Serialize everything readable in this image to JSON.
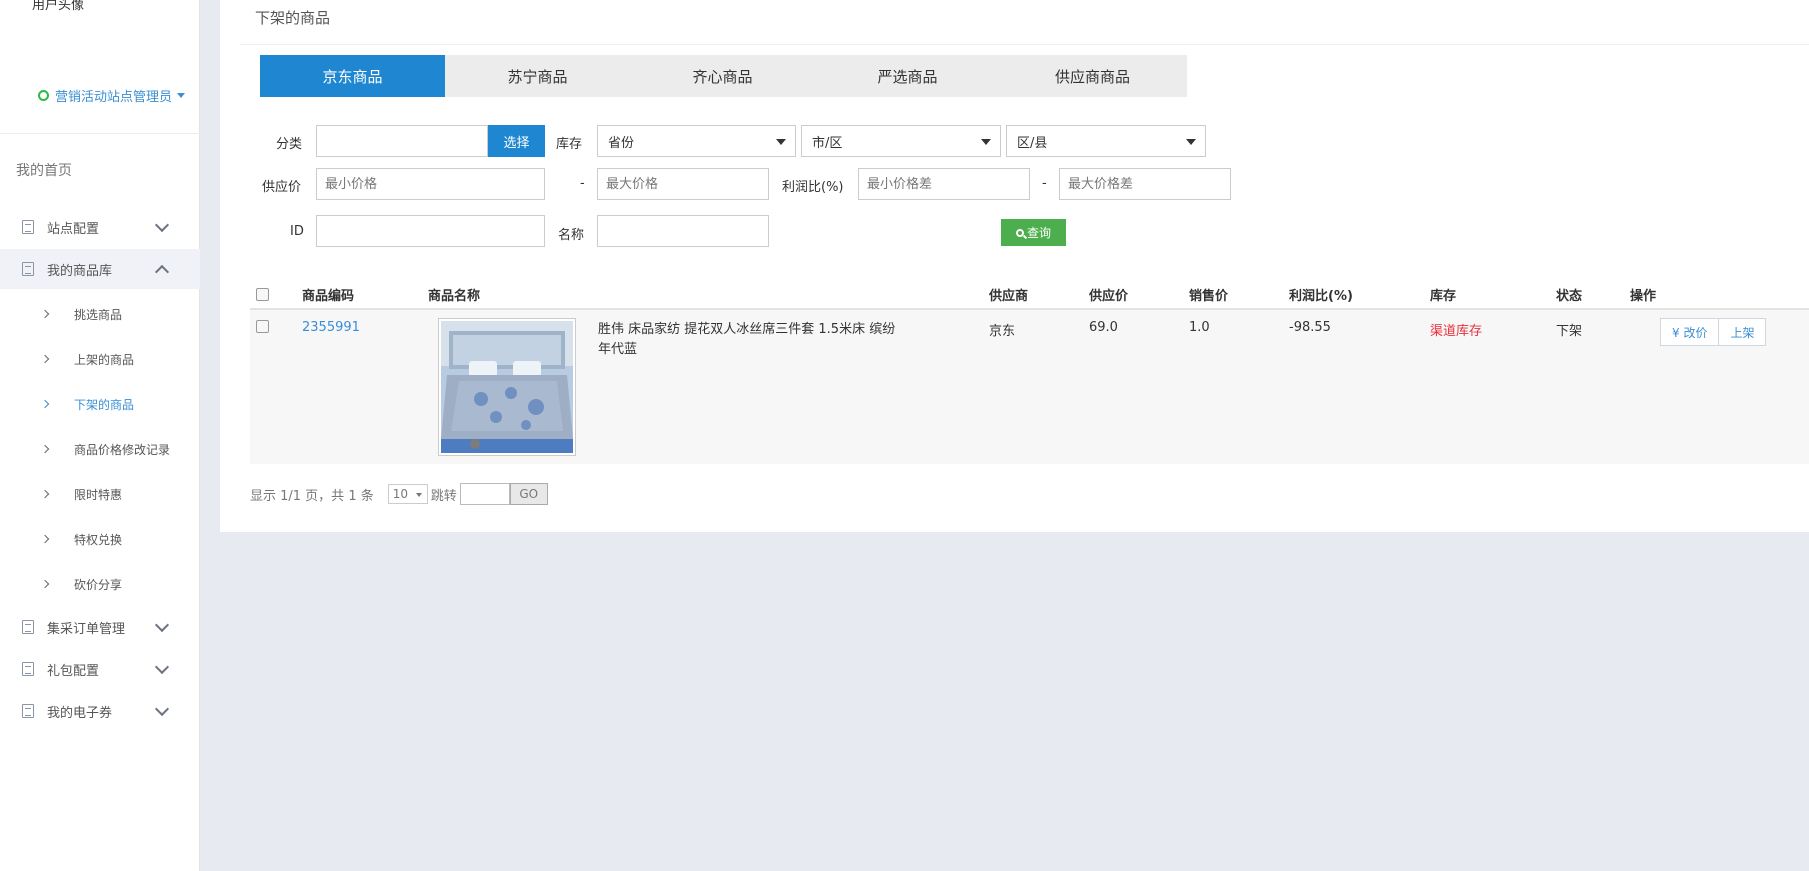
{
  "sidebar": {
    "user_cut": "用户头像",
    "role": "营销活动站点管理员",
    "home": "我的首页",
    "groups": [
      {
        "label": "站点配置"
      },
      {
        "label": "我的商品库"
      },
      {
        "label": "集采订单管理"
      },
      {
        "label": "礼包配置"
      },
      {
        "label": "我的电子券"
      }
    ],
    "subitems": [
      {
        "label": "挑选商品"
      },
      {
        "label": "上架的商品"
      },
      {
        "label": "下架的商品"
      },
      {
        "label": "商品价格修改记录"
      },
      {
        "label": "限时特惠"
      },
      {
        "label": "特权兑换"
      },
      {
        "label": "砍价分享"
      }
    ]
  },
  "page": {
    "title": "下架的商品"
  },
  "tabs": [
    "京东商品",
    "苏宁商品",
    "齐心商品",
    "严选商品",
    "供应商商品"
  ],
  "filters": {
    "category_label": "分类",
    "pick_button": "选择",
    "stock_label": "库存",
    "province": "省份",
    "city": "市/区",
    "district": "区/县",
    "supply_price_label": "供应价",
    "min_price_ph": "最小价格",
    "dash": "-",
    "max_price_ph": "最大价格",
    "profit_label": "利润比(%)",
    "min_diff_ph": "最小价格差",
    "max_diff_ph": "最大价格差",
    "id_label": "ID",
    "name_label": "名称",
    "query_button": "查询"
  },
  "table": {
    "headers": [
      "商品编码",
      "商品名称",
      "供应商",
      "供应价",
      "销售价",
      "利润比(%)",
      "库存",
      "状态",
      "操作"
    ],
    "rows": [
      {
        "code": "2355991",
        "name": "胜伟 床品家纺 提花双人冰丝席三件套 1.5米床 缤纷年代蓝",
        "supplier": "京东",
        "supply_price": "69.0",
        "sale_price": "1.0",
        "profit": "-98.55",
        "stock": "渠道库存",
        "status": "下架",
        "op_price": "¥ 改价",
        "op_shelve": "上架"
      }
    ]
  },
  "pager": {
    "summary": "显示 1/1 页，共 1 条",
    "page_size": "10",
    "jump": "跳转",
    "go": "GO"
  },
  "colors": {
    "primary": "#1f87d1",
    "query_green": "#4cae4c",
    "stock_red": "#e8303c",
    "link": "#3a8ed4"
  }
}
